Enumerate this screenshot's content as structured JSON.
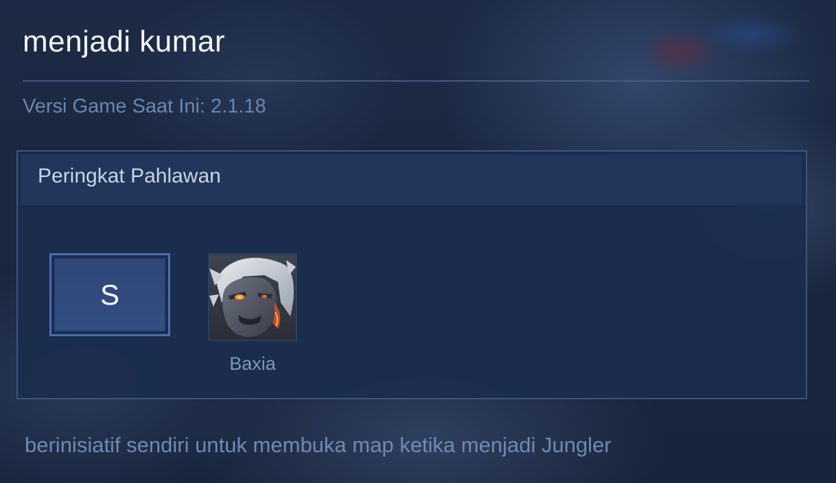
{
  "page": {
    "title": "menjadi kumar",
    "version_text": "Versi Game Saat Ini: 2.1.18"
  },
  "panel": {
    "title": "Peringkat Pahlawan",
    "tier": "S",
    "heroes": [
      {
        "name": "Baxia",
        "portrait": "baxia-portrait"
      }
    ]
  },
  "footer": {
    "note": "berinisiatif sendiri untuk membuka map ketika menjadi Jungler"
  },
  "colors": {
    "background": "#1a2740",
    "panel_border": "#3e5580",
    "tier_border": "#4a6db0",
    "muted_text": "#6f8ab2"
  }
}
